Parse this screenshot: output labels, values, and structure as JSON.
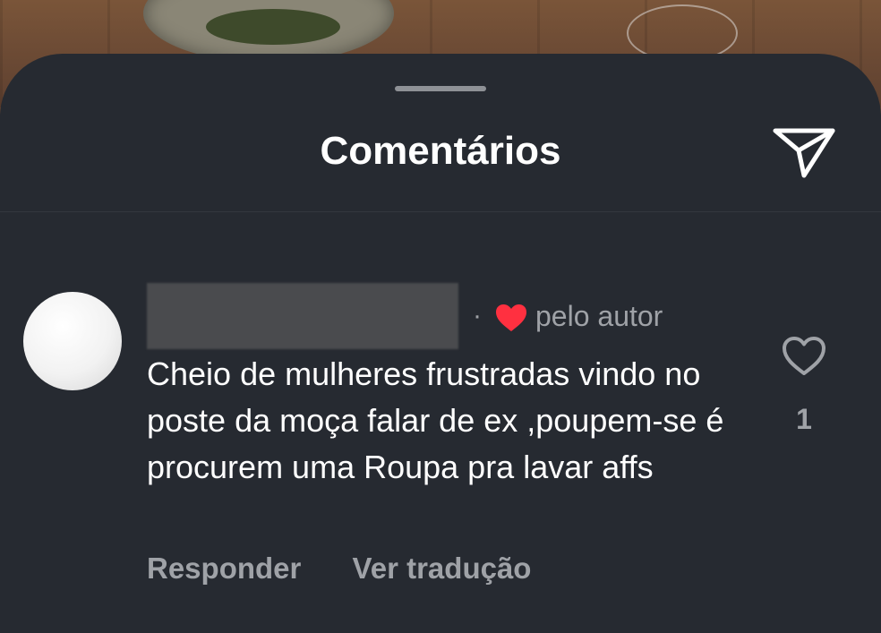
{
  "sheet": {
    "title": "Comentários",
    "send_icon": "send-icon"
  },
  "comment": {
    "separator": "·",
    "liked_by_author_icon": "heart-filled-icon",
    "liked_by_author_color": "#ff3040",
    "liked_by_author_label": "pelo autor",
    "text": "Cheio de mulheres frustradas vindo no poste da moça falar de ex ,poupem-se é procurem uma Roupa pra lavar affs",
    "reply_label": "Responder",
    "translate_label": "Ver tradução",
    "like_icon": "heart-outline-icon",
    "like_count": "1"
  },
  "colors": {
    "sheet_bg": "#262a31",
    "text_primary": "#ffffff",
    "text_secondary": "#9fa2a7"
  }
}
